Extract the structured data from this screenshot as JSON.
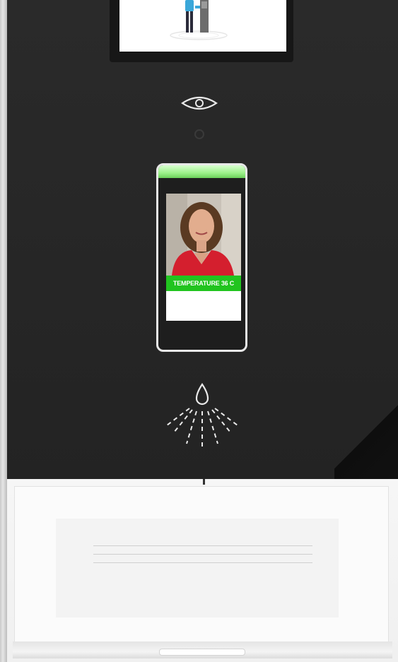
{
  "kiosk": {
    "display": {
      "temperature_label": "TEMPERATURE 36 C"
    },
    "icons": {
      "eye": "eye-icon",
      "sensor": "sensor-icon",
      "sanitizer": "sanitizer-spray-icon"
    },
    "colors": {
      "panel": "#262626",
      "status_green": "#21c41f",
      "tray": "#f3f3f3"
    }
  }
}
